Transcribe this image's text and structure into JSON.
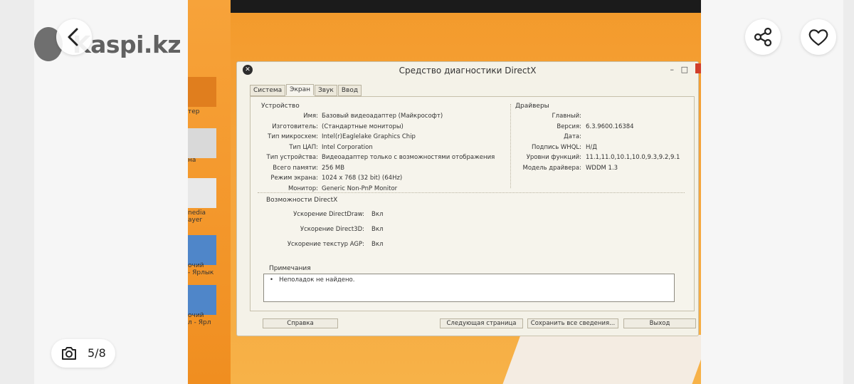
{
  "app": {
    "brand": "Kaspi.kz",
    "counter": "5/8",
    "icons": {
      "back": "chevron-left-icon",
      "share": "share-icon",
      "favorite": "heart-icon",
      "camera": "camera-icon"
    }
  },
  "desktop": {
    "labels": [
      "тер",
      "на",
      "nedia\nayer",
      "очий\n- Ярлык",
      "очий\nл - Ярл"
    ]
  },
  "dxdiag": {
    "title": "Средство диагностики DirectX",
    "tabs": [
      "Система",
      "Экран",
      "Звук",
      "Ввод"
    ],
    "active_tab": "Экран",
    "device_title": "Устройство",
    "device": [
      {
        "label": "Имя:",
        "value": "Базовый видеоадаптер (Майкрософт)"
      },
      {
        "label": "Изготовитель:",
        "value": "(Стандартные мониторы)"
      },
      {
        "label": "Тип микросхем:",
        "value": "Intel(r)Eaglelake Graphics Chip"
      },
      {
        "label": "Тип ЦАП:",
        "value": "Intel Corporation"
      },
      {
        "label": "Тип устройства:",
        "value": "Видеоадаптер только с возможностями отображения"
      },
      {
        "label": "Всего памяти:",
        "value": "256 MB"
      },
      {
        "label": "Режим экрана:",
        "value": "1024 x 768 (32 bit) (64Hz)"
      },
      {
        "label": "Монитор:",
        "value": "Generic Non-PnP Monitor"
      }
    ],
    "drivers_title": "Драйверы",
    "drivers": [
      {
        "label": "Главный:",
        "value": ""
      },
      {
        "label": "Версия:",
        "value": "6.3.9600.16384"
      },
      {
        "label": "Дата:",
        "value": ""
      },
      {
        "label": "Подпись WHQL:",
        "value": "Н/Д"
      },
      {
        "label": "Уровни функций:",
        "value": "11.1,11.0,10.1,10.0,9.3,9.2,9.1"
      },
      {
        "label": "Модель драйвера:",
        "value": "WDDM 1.3"
      }
    ],
    "features_title": "Возможности DirectX",
    "features": [
      {
        "label": "Ускорение DirectDraw:",
        "value": "Вкл"
      },
      {
        "label": "Ускорение Direct3D:",
        "value": "Вкл"
      },
      {
        "label": "Ускорение текстур AGP:",
        "value": "Вкл"
      }
    ],
    "notes_title": "Примечания",
    "notes": "Неполадок не найдено.",
    "buttons": {
      "help": "Справка",
      "next": "Следующая страница",
      "save": "Сохранить все сведения...",
      "exit": "Выход"
    }
  }
}
